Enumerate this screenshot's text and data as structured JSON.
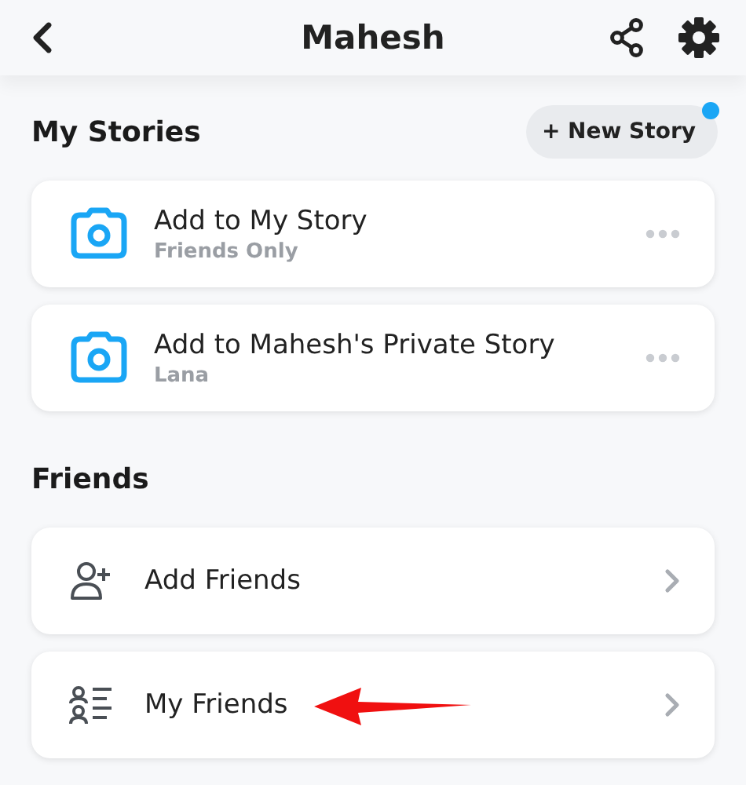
{
  "header": {
    "title": "Mahesh"
  },
  "stories": {
    "title": "My Stories",
    "new_button": {
      "label": "+ New Story",
      "has_notification": true
    },
    "items": [
      {
        "title": "Add to My Story",
        "subtitle": "Friends Only"
      },
      {
        "title": "Add to Mahesh's Private Story",
        "subtitle": "Lana"
      }
    ]
  },
  "friends": {
    "title": "Friends",
    "items": [
      {
        "kind": "add",
        "label": "Add Friends",
        "annotated": false
      },
      {
        "kind": "list",
        "label": "My Friends",
        "annotated": true
      }
    ]
  }
}
